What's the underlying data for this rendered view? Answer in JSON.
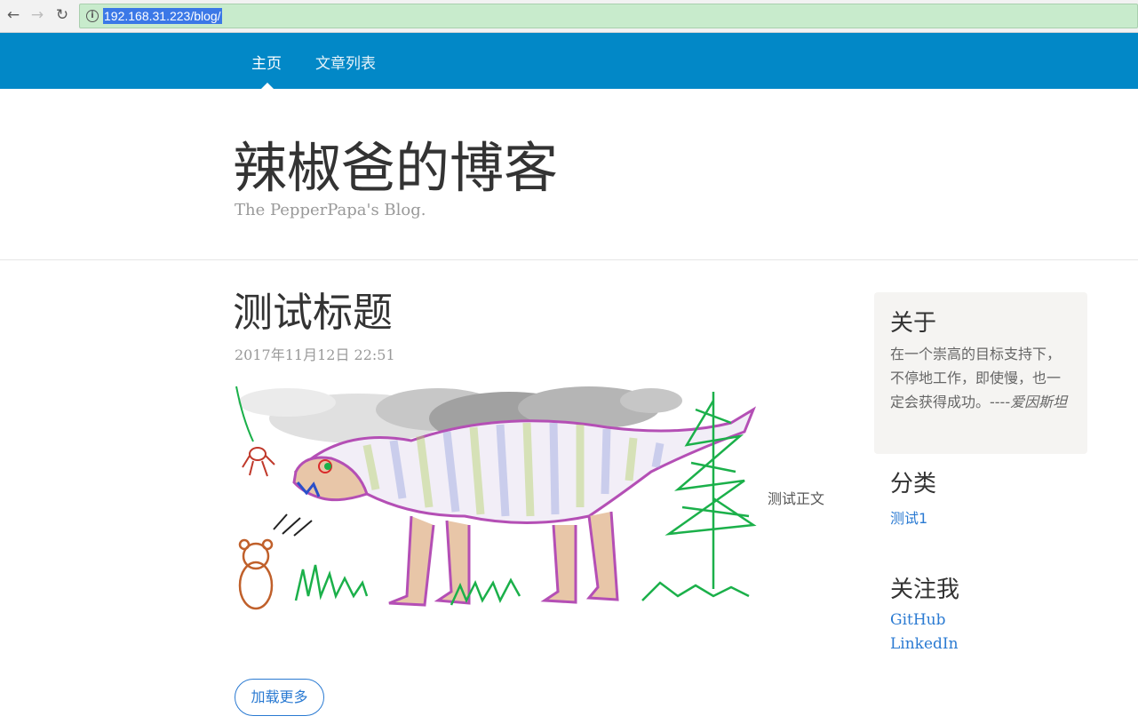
{
  "browser": {
    "back_glyph": "←",
    "forward_glyph": "→",
    "reload_glyph": "↻",
    "info_glyph": "i",
    "url": "192.168.31.223/blog/"
  },
  "nav": {
    "items": [
      {
        "label": "主页",
        "active": true
      },
      {
        "label": "文章列表",
        "active": false
      }
    ]
  },
  "header": {
    "title": "辣椒爸的博客",
    "subtitle": "The PepperPapa's Blog."
  },
  "post": {
    "title": "测试标题",
    "date": "2017年11月12日 22:51",
    "image_icon": "dinosaur-drawing",
    "body": "测试正文"
  },
  "load_more": "加载更多",
  "sidebar": {
    "about": {
      "heading": "关于",
      "text": "在一个崇高的目标支持下，不停地工作，即使慢，也一定会获得成功。----",
      "author": "爱因斯坦"
    },
    "category": {
      "heading": "分类",
      "items": [
        "测试1"
      ]
    },
    "follow": {
      "heading": "关注我",
      "links": [
        "GitHub",
        "LinkedIn"
      ]
    }
  },
  "colors": {
    "navbar": "#0288c7",
    "link": "#2a7ad2",
    "address_bar": "#c8ebcc"
  }
}
